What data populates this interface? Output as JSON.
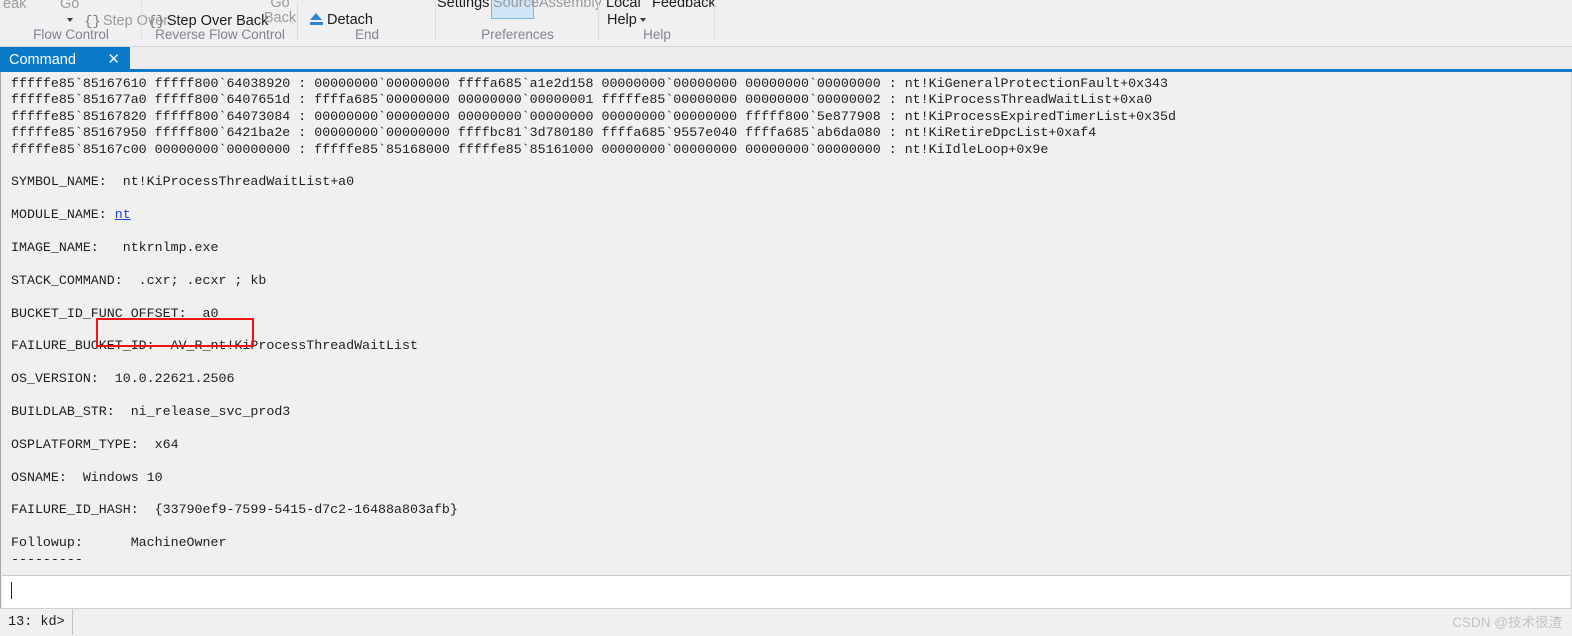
{
  "ribbon": {
    "groups": [
      {
        "label": "Flow Control",
        "items": [
          {
            "text": "eak",
            "kind": "dim-clip"
          },
          {
            "text": "Go",
            "kind": "dim-clip"
          },
          {
            "text": "Step Over",
            "kind": "dim"
          }
        ]
      },
      {
        "label": "Reverse Flow Control",
        "items": [
          {
            "text": "Step Over Back",
            "kind": "normal"
          },
          {
            "text": "Go",
            "kind": "dim-clip"
          },
          {
            "text": "Back",
            "kind": "dim"
          }
        ]
      },
      {
        "label": "End",
        "items": [
          {
            "text": "Detach",
            "kind": "normal"
          }
        ]
      },
      {
        "label": "Preferences",
        "items": [
          {
            "text": "Settings",
            "kind": "clip"
          },
          {
            "text": "Source",
            "kind": "dim-clip"
          },
          {
            "text": "Assembly",
            "kind": "dim-clip"
          }
        ]
      },
      {
        "label": "Help",
        "items": [
          {
            "text": "Local",
            "kind": "clip"
          },
          {
            "text": "Feedback",
            "kind": "clip"
          },
          {
            "text": "Help",
            "kind": "normal"
          }
        ]
      }
    ]
  },
  "tab": {
    "label": "Command",
    "close_glyph": "✕"
  },
  "command_output": {
    "stack_rows": [
      {
        "child_sp": "fffffe85`85167610",
        "ret_addr": "fffff800`64038920",
        "args": "00000000`00000000 ffffa685`a1e2d158 00000000`00000000 00000000`00000000",
        "symbol": "nt!KiGeneralProtectionFault+0x343"
      },
      {
        "child_sp": "fffffe85`851677a0",
        "ret_addr": "fffff800`6407651d",
        "args": "ffffa685`00000000 00000000`00000001 fffffe85`00000000 00000000`00000002",
        "symbol": "nt!KiProcessThreadWaitList+0xa0"
      },
      {
        "child_sp": "fffffe85`85167820",
        "ret_addr": "fffff800`64073084",
        "args": "00000000`00000000 00000000`00000000 00000000`00000000 fffff800`5e877908",
        "symbol": "nt!KiProcessExpiredTimerList+0x35d"
      },
      {
        "child_sp": "fffffe85`85167950",
        "ret_addr": "fffff800`6421ba2e",
        "args": "00000000`00000000 ffffbc81`3d780180 ffffa685`9557e040 ffffa685`ab6da080",
        "symbol": "nt!KiRetireDpcList+0xaf4"
      },
      {
        "child_sp": "fffffe85`85167c00",
        "ret_addr": "00000000`00000000",
        "args": "fffffe85`85168000 fffffe85`85161000 00000000`00000000 00000000`00000000",
        "symbol": "nt!KiIdleLoop+0x9e"
      }
    ],
    "fields": [
      {
        "key": "SYMBOL_NAME:",
        "value": "  nt!KiProcessThreadWaitList+a0"
      },
      {
        "key": "MODULE_NAME:",
        "value": " nt",
        "link": true
      },
      {
        "key": "IMAGE_NAME:",
        "value": "   ntkrnlmp.exe",
        "highlight": true
      },
      {
        "key": "STACK_COMMAND:",
        "value": "  .cxr; .ecxr ; kb"
      },
      {
        "key": "BUCKET_ID_FUNC_OFFSET:",
        "value": "  a0"
      },
      {
        "key": "FAILURE_BUCKET_ID:",
        "value": "  AV_R_nt!KiProcessThreadWaitList"
      },
      {
        "key": "OS_VERSION:",
        "value": "  10.0.22621.2506"
      },
      {
        "key": "BUILDLAB_STR:",
        "value": "  ni_release_svc_prod3"
      },
      {
        "key": "OSPLATFORM_TYPE:",
        "value": "  x64"
      },
      {
        "key": "OSNAME:",
        "value": "  Windows 10"
      },
      {
        "key": "FAILURE_ID_HASH:",
        "value": "  {33790ef9-7599-5415-d7c2-16488a803afb}"
      },
      {
        "key": "Followup:",
        "value": "      MachineOwner"
      }
    ],
    "rule": "---------",
    "input_value": ""
  },
  "status": {
    "prompt": "13: kd>",
    "watermark": "CSDN @技术很渣"
  },
  "colors": {
    "accent": "#0a7ac8",
    "highlight": "#f01414",
    "link": "#1a3fd4",
    "pane_bg": "#f0f0f0"
  }
}
